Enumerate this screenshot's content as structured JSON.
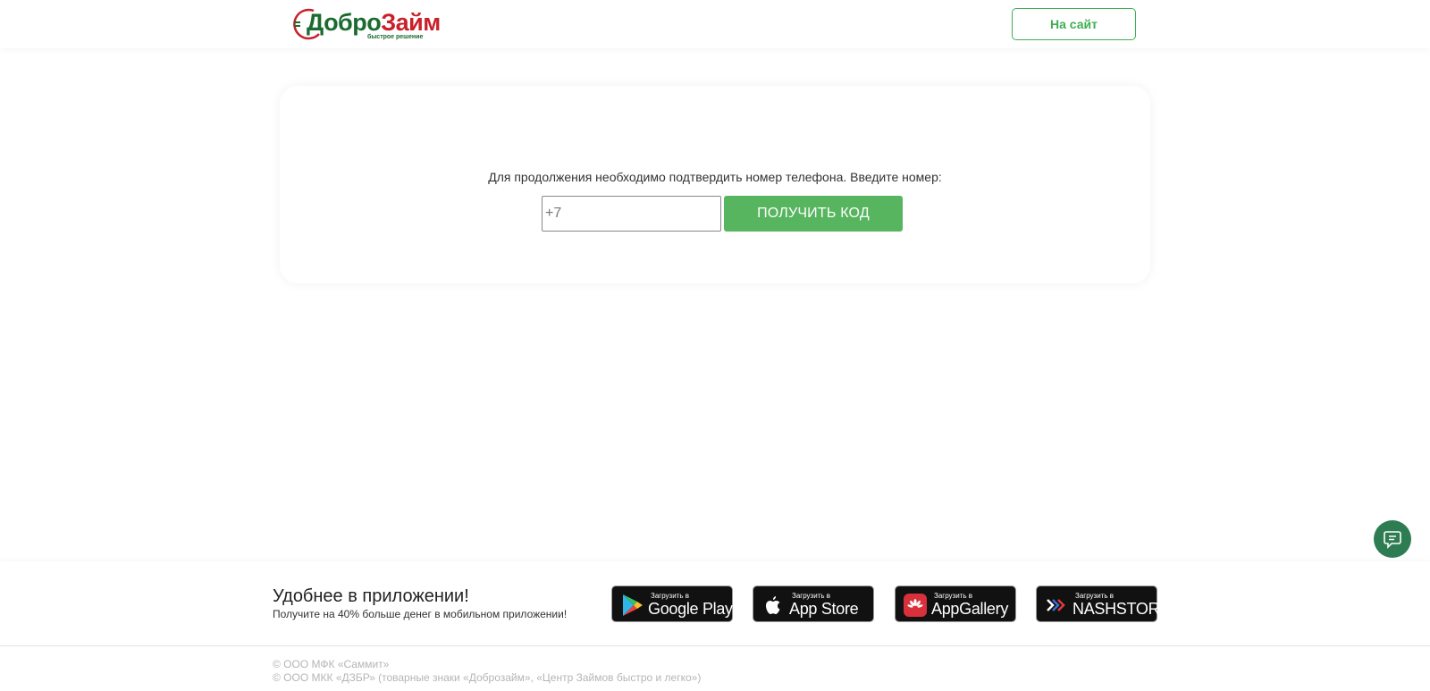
{
  "header": {
    "logo_part1": "Добро",
    "logo_part2": "Займ",
    "logo_tagline": "быстрое решение",
    "site_button": "На сайт"
  },
  "verify": {
    "prompt": "Для продолжения необходимо подтвердить номер телефона. Введите номер:",
    "phone_placeholder": "+7",
    "phone_value": "",
    "submit_label": "ПОЛУЧИТЬ КОД"
  },
  "footer": {
    "app_title": "Удобнее в приложении!",
    "app_subtitle": "Получите на 40% больше денег в мобильном приложении!",
    "stores": [
      {
        "small": "Загрузить в",
        "big": "Google Play",
        "icon": "google-play-icon"
      },
      {
        "small": "Загрузить в",
        "big": "App Store",
        "icon": "apple-icon"
      },
      {
        "small": "Загрузить в",
        "big": "AppGallery",
        "icon": "huawei-icon"
      },
      {
        "small": "Загрузить в",
        "big": "NASHSTORE",
        "icon": "nashstore-icon"
      }
    ],
    "copyright": [
      "© ООО МФК «Саммит»",
      "© ООО МКК «ДЗБР» (товарные знаки «Доброзайм», «Центр Займов быстро и легко»)"
    ]
  },
  "colors": {
    "brand_green": "#3fae54",
    "button_green": "#58b55f",
    "logo_dark_green": "#1a6b2f",
    "logo_red": "#c9202a",
    "chat_green": "#2e7d52"
  }
}
